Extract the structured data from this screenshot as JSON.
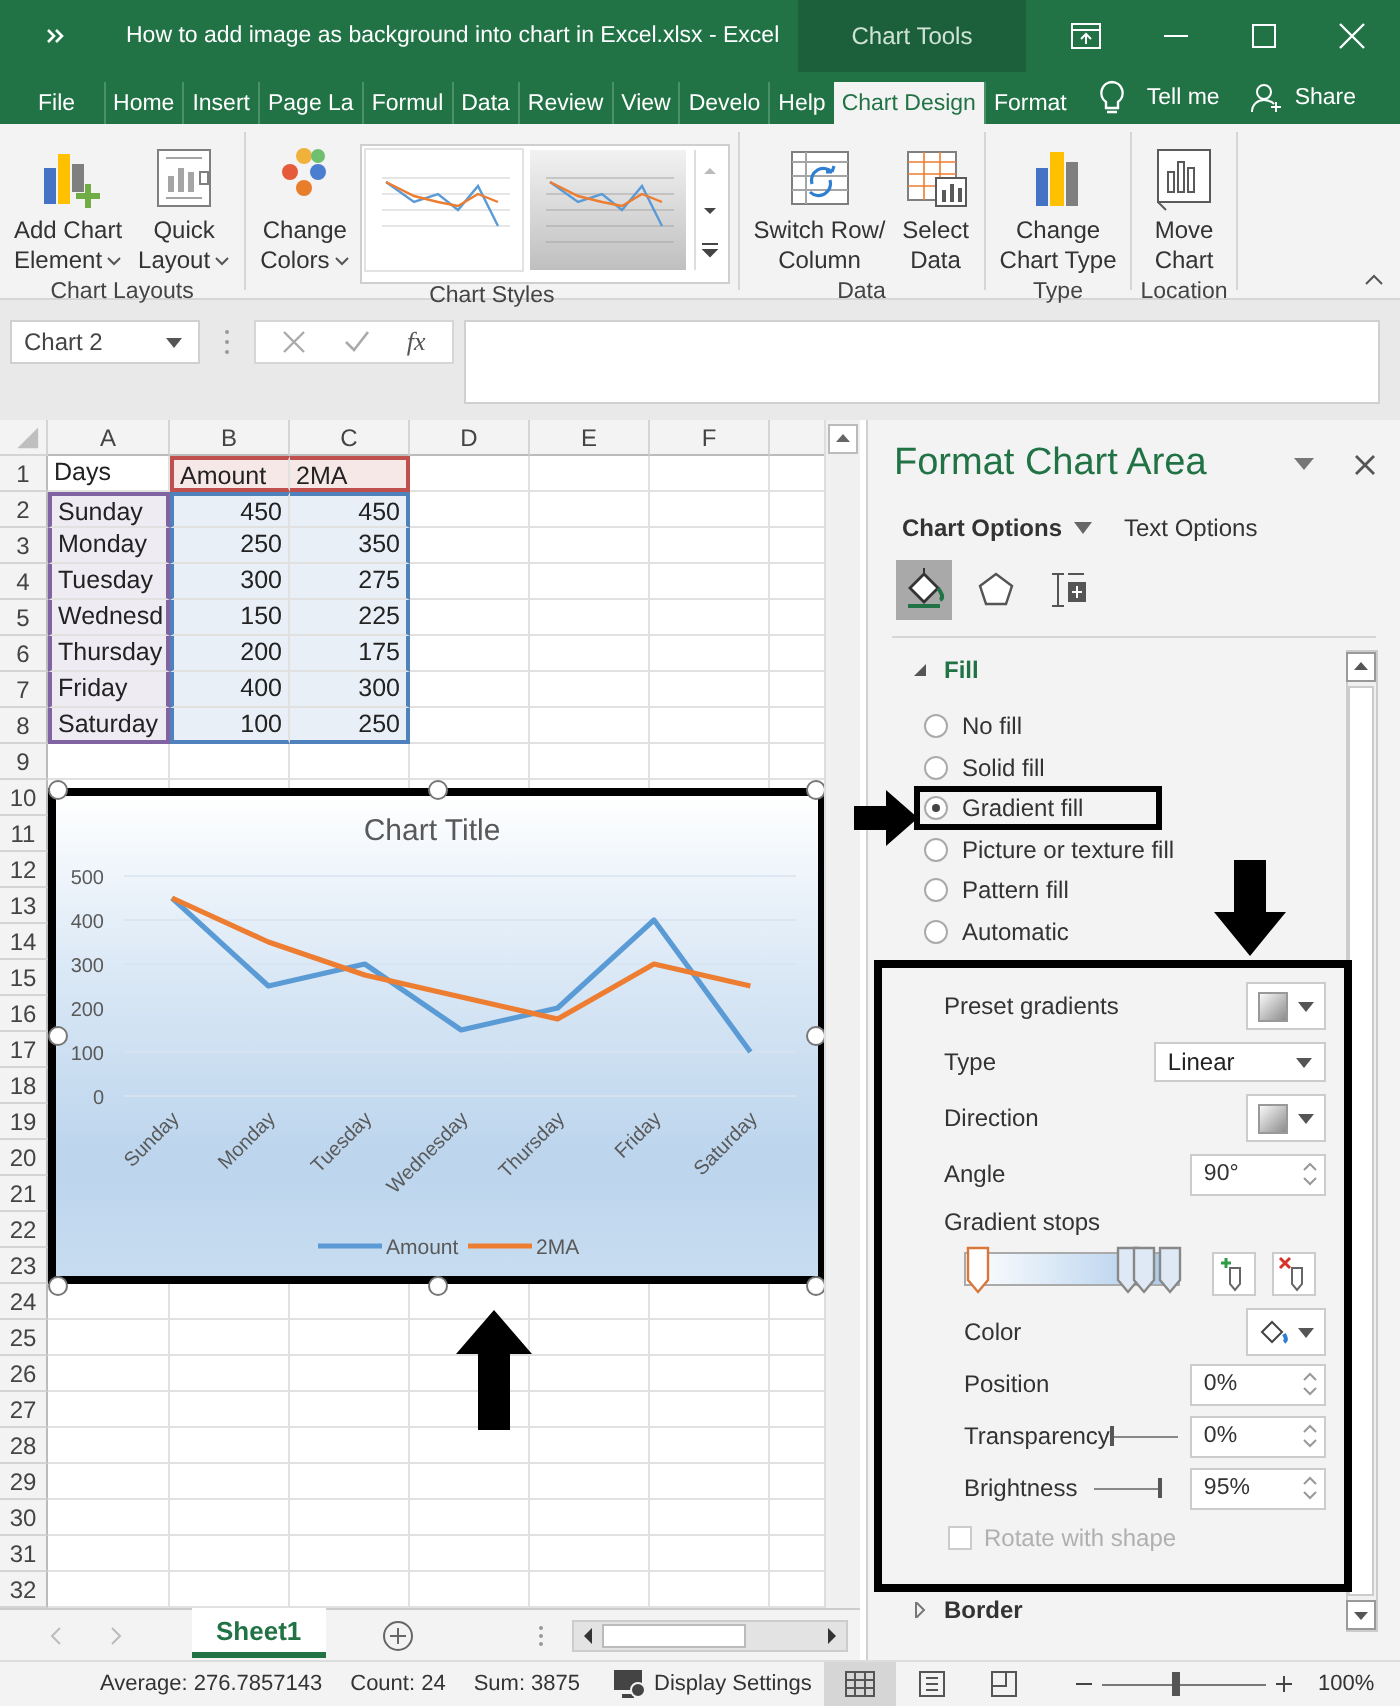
{
  "title_bar": {
    "title": "How to add image as background into chart in Excel.xlsx  -  Excel",
    "context_label": "Chart Tools"
  },
  "ribbon_tabs": [
    {
      "label": "File",
      "selected": false
    },
    {
      "label": "Home",
      "selected": false
    },
    {
      "label": "Insert",
      "selected": false
    },
    {
      "label": "Page La",
      "selected": false
    },
    {
      "label": "Formul",
      "selected": false
    },
    {
      "label": "Data",
      "selected": false
    },
    {
      "label": "Review",
      "selected": false
    },
    {
      "label": "View",
      "selected": false
    },
    {
      "label": "Develo",
      "selected": false
    },
    {
      "label": "Help",
      "selected": false
    },
    {
      "label": "Chart Design",
      "selected": true
    },
    {
      "label": "Format",
      "selected": false
    }
  ],
  "tell_me": "Tell me",
  "share": "Share",
  "ribbon_groups": [
    {
      "label": "Chart Layouts",
      "items": [
        {
          "kind": "element",
          "lines": [
            "Add Chart",
            "Element"
          ],
          "dropdown": true
        },
        {
          "kind": "layout",
          "lines": [
            "Quick",
            "Layout"
          ],
          "dropdown": true
        }
      ]
    },
    {
      "label": "Chart Styles",
      "items": [
        {
          "kind": "colors",
          "lines": [
            "Change",
            "Colors"
          ],
          "dropdown": true
        },
        {
          "kind": "gallery"
        }
      ]
    },
    {
      "label": "Data",
      "items": [
        {
          "kind": "switch",
          "lines": [
            "Switch Row/",
            "Column"
          ],
          "dropdown": false
        },
        {
          "kind": "select",
          "lines": [
            "Select",
            "Data"
          ],
          "dropdown": false
        }
      ]
    },
    {
      "label": "Type",
      "items": [
        {
          "kind": "type",
          "lines": [
            "Change",
            "Chart Type"
          ],
          "dropdown": false
        }
      ]
    },
    {
      "label": "Location",
      "items": [
        {
          "kind": "move",
          "lines": [
            "Move",
            "Chart"
          ],
          "dropdown": false
        }
      ]
    }
  ],
  "formula_bar": {
    "name_box": "Chart 2",
    "function_label": "fx"
  },
  "sheet": {
    "columns": [
      "A",
      "B",
      "C",
      "D",
      "E",
      "F"
    ],
    "rows": [
      {
        "number": "1",
        "cells": [
          {
            "text": "Days"
          },
          {
            "text": "Amount",
            "color": "#c0504d"
          },
          {
            "text": "2MA",
            "color": "#c0504d"
          }
        ]
      },
      {
        "number": "2",
        "cells": [
          {
            "text": "Sunday",
            "color": "#8064a2"
          },
          {
            "text": "450",
            "kind": "number",
            "color": "#4f81bd"
          },
          {
            "text": "450",
            "kind": "number",
            "color": "#4f81bd"
          }
        ]
      },
      {
        "number": "3",
        "cells": [
          {
            "text": "Monday",
            "color": "#8064a2"
          },
          {
            "text": "250",
            "kind": "number",
            "color": "#4f81bd"
          },
          {
            "text": "350",
            "kind": "number",
            "color": "#4f81bd"
          }
        ]
      },
      {
        "number": "4",
        "cells": [
          {
            "text": "Tuesday",
            "color": "#8064a2"
          },
          {
            "text": "300",
            "kind": "number",
            "color": "#4f81bd"
          },
          {
            "text": "275",
            "kind": "number",
            "color": "#4f81bd"
          }
        ]
      },
      {
        "number": "5",
        "cells": [
          {
            "text": "Wednesd",
            "color": "#8064a2"
          },
          {
            "text": "150",
            "kind": "number",
            "color": "#4f81bd"
          },
          {
            "text": "225",
            "kind": "number",
            "color": "#4f81bd"
          }
        ]
      },
      {
        "number": "6",
        "cells": [
          {
            "text": "Thursday",
            "color": "#8064a2"
          },
          {
            "text": "200",
            "kind": "number",
            "color": "#4f81bd"
          },
          {
            "text": "175",
            "kind": "number",
            "color": "#4f81bd"
          }
        ]
      },
      {
        "number": "7",
        "cells": [
          {
            "text": "Friday",
            "color": "#8064a2"
          },
          {
            "text": "400",
            "kind": "number",
            "color": "#4f81bd"
          },
          {
            "text": "300",
            "kind": "number",
            "color": "#4f81bd"
          }
        ]
      },
      {
        "number": "8",
        "cells": [
          {
            "text": "Saturday",
            "color": "#8064a2"
          },
          {
            "text": "100",
            "kind": "number",
            "color": "#4f81bd"
          },
          {
            "text": "250",
            "kind": "number",
            "color": "#4f81bd"
          }
        ]
      },
      {
        "number": "9"
      },
      {
        "number": "10"
      },
      {
        "number": "11"
      },
      {
        "number": "12"
      },
      {
        "number": "13"
      },
      {
        "number": "14"
      },
      {
        "number": "15"
      },
      {
        "number": "16"
      },
      {
        "number": "17"
      },
      {
        "number": "18"
      },
      {
        "number": "19"
      },
      {
        "number": "20"
      },
      {
        "number": "21"
      },
      {
        "number": "22"
      },
      {
        "number": "23"
      },
      {
        "number": "24"
      },
      {
        "number": "25"
      },
      {
        "number": "26"
      },
      {
        "number": "27"
      },
      {
        "number": "28"
      },
      {
        "number": "29"
      },
      {
        "number": "30"
      },
      {
        "number": "31"
      },
      {
        "number": "32"
      }
    ]
  },
  "chart": {
    "chart_data": {
      "type": "line",
      "title": "Chart Title",
      "categories": [
        "Sunday",
        "Monday",
        "Tuesday",
        "Wednesday",
        "Thursday",
        "Friday",
        "Saturday"
      ],
      "series": [
        {
          "name": "Amount",
          "color": "#5b9bd5",
          "values": [
            450,
            250,
            300,
            150,
            200,
            400,
            100
          ]
        },
        {
          "name": "2MA",
          "color": "#ed7d31",
          "values": [
            450,
            350,
            275,
            225,
            175,
            300,
            250
          ]
        }
      ],
      "yticks": [
        0,
        100,
        200,
        300,
        400,
        500
      ],
      "ylim": [
        0,
        500
      ],
      "grid": true,
      "legend": true
    }
  },
  "sheet_tabs": [
    {
      "label": "Sheet1",
      "selected": true
    }
  ],
  "pane": {
    "title": "Format Chart Area",
    "option_tabs": [
      {
        "label": "Chart Options",
        "selected": true
      },
      {
        "label": "Text Options",
        "selected": false
      }
    ],
    "icon_tabs": [
      {
        "kind": "fill",
        "selected": true
      },
      {
        "kind": "effects",
        "selected": false
      },
      {
        "kind": "size",
        "selected": false
      }
    ],
    "fill": {
      "label": "Fill",
      "expanded": true,
      "options": [
        {
          "label": "No fill",
          "selected": false
        },
        {
          "label": "Solid fill",
          "selected": false
        },
        {
          "label": "Gradient fill",
          "selected": true
        },
        {
          "label": "Picture or texture fill",
          "selected": false
        },
        {
          "label": "Pattern fill",
          "selected": false
        },
        {
          "label": "Automatic",
          "selected": false
        }
      ],
      "gradient": {
        "preset_label": "Preset gradients",
        "type_label": "Type",
        "type_value": "Linear",
        "direction_label": "Direction",
        "angle_label": "Angle",
        "angle_value": "90°",
        "stops_label": "Gradient stops",
        "stops": [
          {
            "level": 0,
            "selected": true
          },
          {
            "level": 0.78,
            "selected": false
          },
          {
            "level": 0.86,
            "selected": false
          },
          {
            "level": 1,
            "selected": false
          }
        ],
        "color_label": "Color",
        "position_label": "Position",
        "position_value": "0%",
        "transparency": {
          "label": "Transparency",
          "level": 0,
          "value": "0%"
        },
        "brightness": {
          "label": "Brightness",
          "level": 1,
          "value": "95%"
        },
        "rotate": {
          "label": "Rotate with shape",
          "checked": false,
          "disabled": true
        }
      }
    },
    "border": {
      "label": "Border",
      "expanded": false
    }
  },
  "status_bar": {
    "average": "Average: 276.7857143",
    "count": "Count: 24",
    "sum": "Sum: 3875",
    "display_settings": "Display Settings",
    "views": [
      {
        "kind": "normal",
        "selected": true
      },
      {
        "kind": "page",
        "selected": false
      },
      {
        "kind": "break",
        "selected": false
      }
    ],
    "zoom": {
      "level": 0.45,
      "label": "100%"
    }
  }
}
